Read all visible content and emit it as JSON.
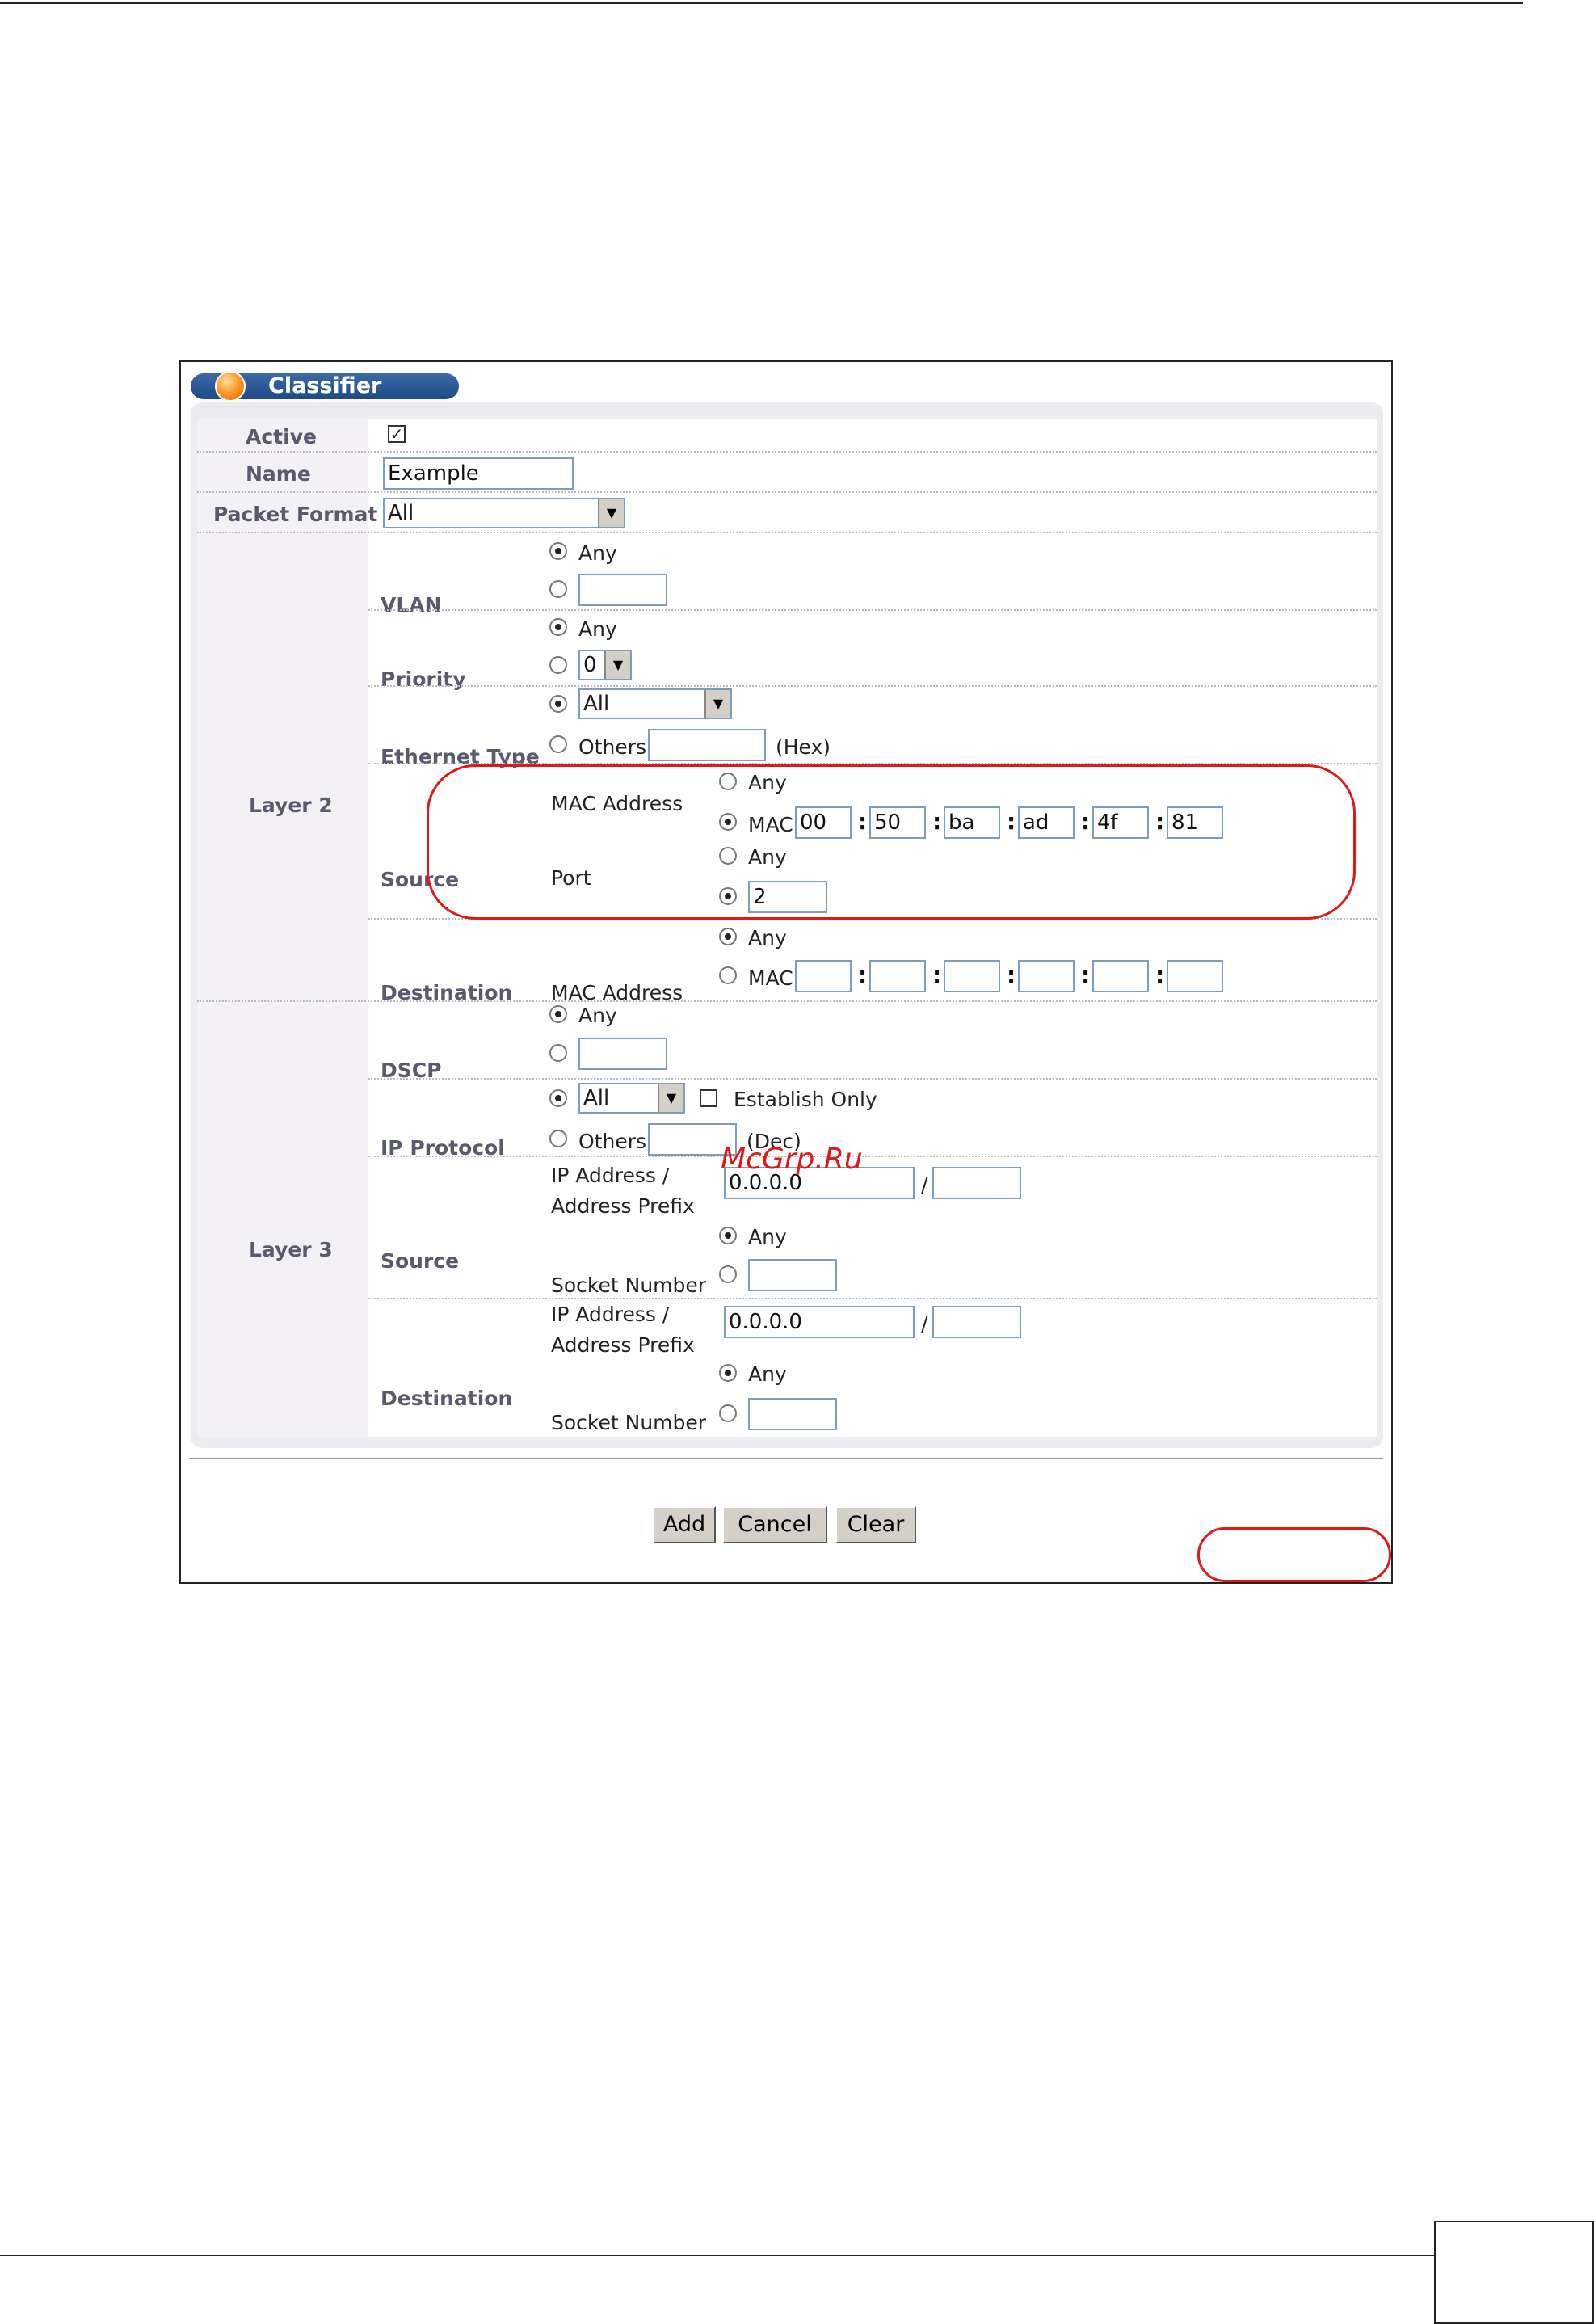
{
  "panel": {
    "title": "Classifier"
  },
  "fields": {
    "active_label": "Active",
    "active_checked": true,
    "name_label": "Name",
    "name_value": "Example",
    "packet_format_label": "Packet Format",
    "packet_format_value": "All"
  },
  "layer2": {
    "label": "Layer 2",
    "vlan": {
      "label": "VLAN",
      "any": "Any",
      "selected": "Any"
    },
    "priority": {
      "label": "Priority",
      "any": "Any",
      "value": "0",
      "selected": "Any"
    },
    "ethernet_type": {
      "label": "Ethernet Type",
      "value": "All",
      "others": "Others",
      "hex": "(Hex)",
      "selected": "All"
    },
    "source": {
      "label": "Source",
      "mac_address_label": "MAC Address",
      "any": "Any",
      "mac": "MAC",
      "mac_octets": [
        "00",
        "50",
        "ba",
        "ad",
        "4f",
        "81"
      ],
      "mac_selected": "MAC",
      "port_label": "Port",
      "port_any": "Any",
      "port_value": "2",
      "port_selected": "value"
    },
    "destination": {
      "label": "Destination",
      "mac_address_label": "MAC Address",
      "any": "Any",
      "mac": "MAC",
      "mac_octets": [
        "",
        "",
        "",
        "",
        "",
        ""
      ],
      "selected": "Any"
    }
  },
  "layer3": {
    "label": "Layer 3",
    "dscp": {
      "label": "DSCP",
      "any": "Any",
      "selected": "Any"
    },
    "ip_protocol": {
      "label": "IP Protocol",
      "value": "All",
      "establish_only": "Establish Only",
      "establish_checked": false,
      "others": "Others",
      "dec": "(Dec)",
      "selected": "All"
    },
    "source": {
      "label": "Source",
      "ip_label_1": "IP Address /",
      "ip_label_2": "Address Prefix",
      "ip_value": "0.0.0.0",
      "slash": "/",
      "socket_label": "Socket Number",
      "any": "Any",
      "selected": "Any"
    },
    "destination": {
      "label": "Destination",
      "ip_label_1": "IP Address /",
      "ip_label_2": "Address Prefix",
      "ip_value": "0.0.0.0",
      "slash": "/",
      "socket_label": "Socket Number",
      "any": "Any",
      "selected": "Any"
    }
  },
  "buttons": {
    "add": "Add",
    "cancel": "Cancel",
    "clear": "Clear"
  },
  "watermark": "McGrp.Ru",
  "colors": {
    "title_bar": "#1d4b87",
    "highlight_oval": "#e01818",
    "label_text": "#5a5a6e"
  }
}
